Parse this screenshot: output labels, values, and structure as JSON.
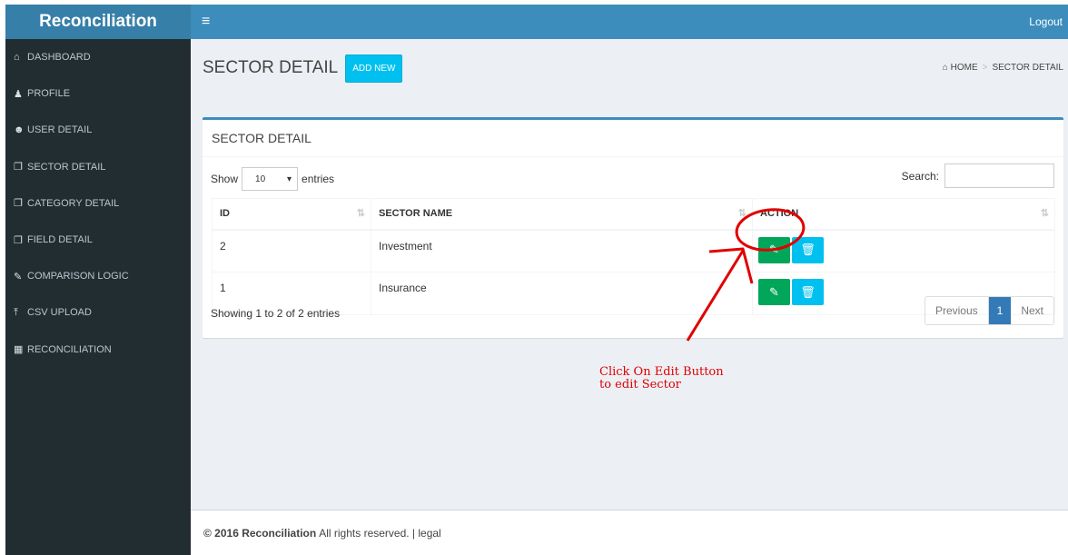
{
  "app": {
    "brand": "Reconciliation",
    "toggle_icon": "≡",
    "logout": "Logout"
  },
  "sidebar": {
    "items": [
      {
        "icon": "home-icon",
        "glyph": "⌂",
        "label": "DASHBOARD"
      },
      {
        "icon": "user-icon",
        "glyph": "♟",
        "label": "PROFILE"
      },
      {
        "icon": "users-icon",
        "glyph": "☻",
        "label": "USER DETAIL"
      },
      {
        "icon": "copy-icon",
        "glyph": "❐",
        "label": "SECTOR DETAIL"
      },
      {
        "icon": "copy-icon",
        "glyph": "❐",
        "label": "CATEGORY DETAIL"
      },
      {
        "icon": "copy-icon",
        "glyph": "❐",
        "label": "FIELD DETAIL"
      },
      {
        "icon": "edit-icon",
        "glyph": "✎",
        "label": "COMPARISON LOGIC"
      },
      {
        "icon": "upload-icon",
        "glyph": "⤒",
        "label": "CSV UPLOAD"
      },
      {
        "icon": "calculator-icon",
        "glyph": "▦",
        "label": "RECONCILIATION"
      }
    ]
  },
  "page": {
    "title": "SECTOR DETAIL",
    "add_new": "ADD NEW",
    "breadcrumb_home": "HOME",
    "breadcrumb_sep": ">",
    "breadcrumb_current": "SECTOR DETAIL"
  },
  "box": {
    "title": "SECTOR DETAIL",
    "show_label": "Show",
    "entries_value": "10",
    "entries_label": "entries",
    "search_label": "Search:",
    "search_value": ""
  },
  "table": {
    "headers": [
      "ID",
      "SECTOR NAME",
      "ACTION"
    ],
    "rows": [
      {
        "id": "2",
        "name": "Investment"
      },
      {
        "id": "1",
        "name": "Insurance"
      }
    ]
  },
  "pagination": {
    "info": "Showing 1 to 2 of 2 entries",
    "previous": "Previous",
    "current": "1",
    "next": "Next"
  },
  "annotation": {
    "line1": "Click On Edit Button",
    "line2": "to edit Sector",
    "color": "#e00000"
  },
  "footer": {
    "copyright": "© 2016 Reconciliation",
    "rest": "All rights reserved. | legal"
  }
}
